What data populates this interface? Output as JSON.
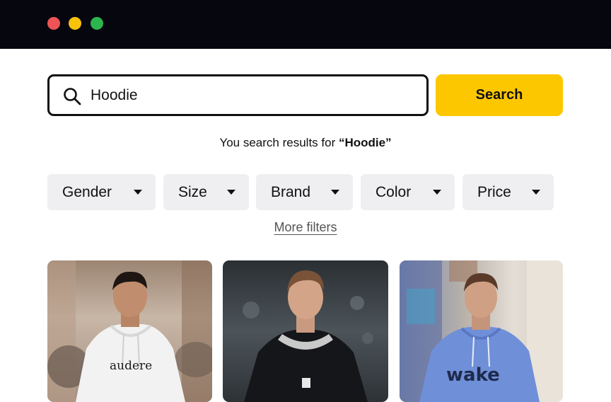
{
  "window": {
    "controls": [
      "close",
      "minimize",
      "maximize"
    ]
  },
  "search": {
    "value": "Hoodie",
    "button_label": "Search",
    "icon": "search-icon"
  },
  "results": {
    "caption_prefix": "You search results for ",
    "query": "“Hoodie”"
  },
  "filters": [
    {
      "label": "Gender"
    },
    {
      "label": "Size"
    },
    {
      "label": "Brand"
    },
    {
      "label": "Color"
    },
    {
      "label": "Price"
    }
  ],
  "more_filters_label": "More filters",
  "products": [
    {
      "hoodie_print": "audere",
      "hoodie_color": "#f2f2f2"
    },
    {
      "hoodie_print": "",
      "hoodie_color": "#15161a"
    },
    {
      "hoodie_print": "wake",
      "hoodie_color": "#6f8fd8"
    }
  ],
  "colors": {
    "accent": "#fdc700",
    "titlebar": "#06060f",
    "filter_bg": "#efeff1"
  }
}
